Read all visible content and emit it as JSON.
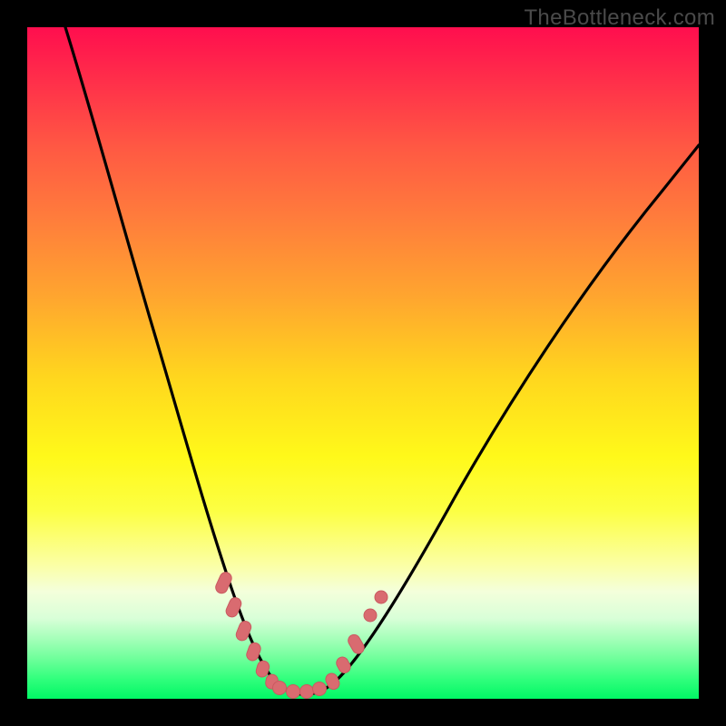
{
  "watermark": {
    "text": "TheBottleneck.com"
  },
  "colors": {
    "page_bg": "#000000",
    "curve": "#000000",
    "marker_fill": "#d96b70",
    "marker_stroke": "#c95a60"
  },
  "chart_data": {
    "type": "line",
    "title": "",
    "xlabel": "",
    "ylabel": "",
    "xlim": [
      0,
      1
    ],
    "ylim": [
      0,
      100
    ],
    "grid": false,
    "legend": false,
    "annotations": [],
    "series": [
      {
        "name": "bottleneck-curve",
        "x": [
          0.0,
          0.03,
          0.06,
          0.09,
          0.12,
          0.15,
          0.18,
          0.21,
          0.24,
          0.27,
          0.3,
          0.32,
          0.34,
          0.36,
          0.38,
          0.4,
          0.42,
          0.44,
          0.47,
          0.5,
          0.55,
          0.6,
          0.65,
          0.7,
          0.75,
          0.8,
          0.85,
          0.9,
          0.95,
          1.0
        ],
        "y": [
          100,
          90,
          80,
          70,
          61,
          52,
          43,
          35,
          27,
          20,
          14,
          10,
          7,
          4.5,
          3,
          2,
          2,
          2.5,
          4,
          7,
          13,
          20,
          27,
          34,
          41,
          48,
          55,
          62,
          68,
          74
        ]
      },
      {
        "name": "highlight-markers",
        "x": [
          0.27,
          0.285,
          0.3,
          0.32,
          0.34,
          0.355,
          0.37,
          0.385,
          0.4,
          0.415,
          0.43,
          0.445,
          0.46,
          0.475,
          0.49
        ],
        "y": [
          20,
          17,
          14,
          10,
          7,
          5.5,
          4,
          3,
          2.2,
          2,
          2.2,
          2.8,
          4,
          5.5,
          7.5
        ]
      }
    ]
  }
}
